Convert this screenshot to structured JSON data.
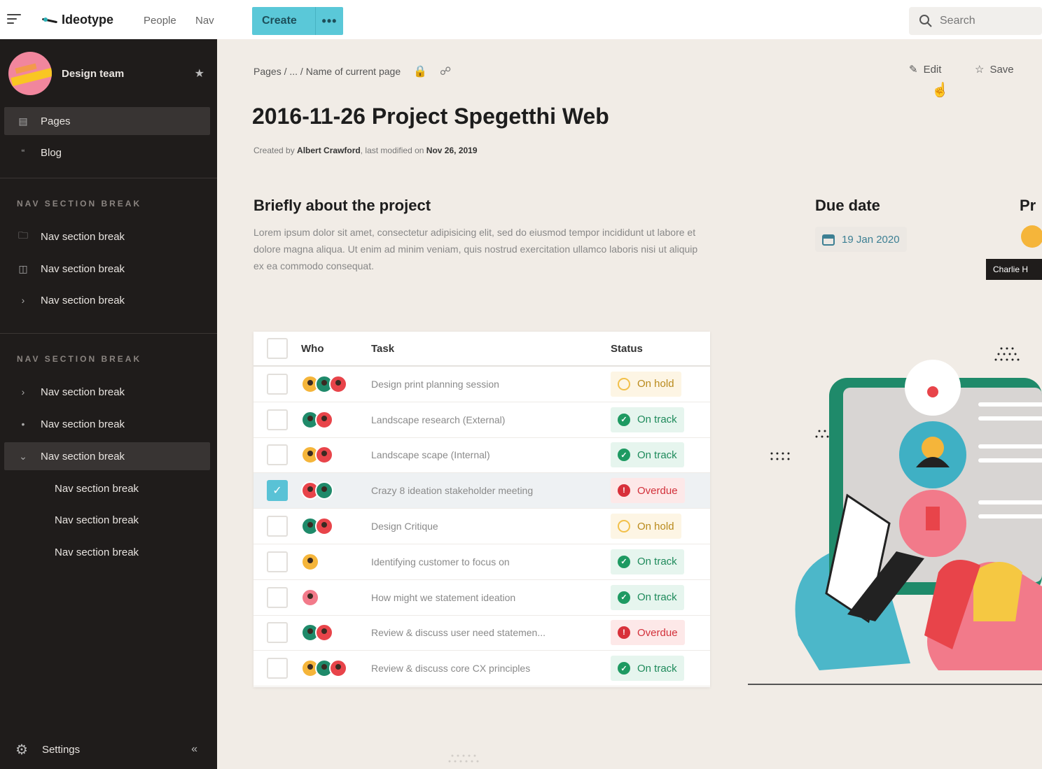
{
  "topbar": {
    "logo": "Ideotype",
    "nav": [
      "People",
      "Nav"
    ],
    "create_label": "Create",
    "create_more": "•••",
    "search_placeholder": "Search"
  },
  "sidebar": {
    "team_name": "Design team",
    "primary_items": [
      {
        "label": "Pages",
        "icon": "pages-icon",
        "active": true
      },
      {
        "label": "Blog",
        "icon": "quote-icon",
        "active": false
      }
    ],
    "section1": {
      "heading": "NAV SECTION BREAK",
      "items": [
        {
          "label": "Nav section break",
          "icon": "folder-icon"
        },
        {
          "label": "Nav section break",
          "icon": "book-icon"
        },
        {
          "label": "Nav section break",
          "icon": "chevron-right-icon"
        }
      ]
    },
    "section2": {
      "heading": "NAV SECTION BREAK",
      "items": [
        {
          "label": "Nav section break",
          "icon": "chevron-right-icon"
        },
        {
          "label": "Nav section break",
          "icon": "bullet-icon"
        },
        {
          "label": "Nav section break",
          "icon": "chevron-down-icon",
          "active": true
        }
      ],
      "sub_items": [
        "Nav section break",
        "Nav section break",
        "Nav section break"
      ]
    },
    "settings_label": "Settings"
  },
  "page": {
    "breadcrumb": "Pages / ... / Name of current page",
    "edit_label": "Edit",
    "save_label": "Save",
    "title": "2016-11-26 Project Spegetthi Web",
    "byline_prefix": "Created by",
    "author": "Albert Crawford",
    "byline_mid": ", last modified on",
    "modified": "Nov 26, 2019",
    "about_title": "Briefly about the project",
    "about_text": "Lorem ipsum dolor sit amet, consectetur adipisicing elit, sed do eiusmod tempor incididunt ut labore et dolore magna aliqua. Ut enim ad minim veniam, quis nostrud exercitation ullamco laboris nisi ut aliquip ex ea commodo consequat.",
    "due_title": "Due date",
    "due_date": "19 Jan 2020",
    "pr_title": "Pr",
    "tooltip": "Charlie H"
  },
  "table": {
    "headers": {
      "who": "Who",
      "task": "Task",
      "status": "Status"
    },
    "rows": [
      {
        "avatars": [
          "o",
          "g",
          "r"
        ],
        "task": "Design print planning session",
        "status": "On hold",
        "kind": "hold",
        "checked": false
      },
      {
        "avatars": [
          "g",
          "r"
        ],
        "task": "Landscape research (External)",
        "status": "On track",
        "kind": "track",
        "checked": false
      },
      {
        "avatars": [
          "o",
          "r"
        ],
        "task": "Landscape scape (Internal)",
        "status": "On track",
        "kind": "track",
        "checked": false
      },
      {
        "avatars": [
          "r",
          "g"
        ],
        "task": "Crazy 8 ideation stakeholder meeting",
        "status": "Overdue",
        "kind": "overdue",
        "checked": true
      },
      {
        "avatars": [
          "g",
          "r"
        ],
        "task": "Design Critique",
        "status": "On hold",
        "kind": "hold",
        "checked": false
      },
      {
        "avatars": [
          "o"
        ],
        "task": "Identifying customer to focus on",
        "status": "On track",
        "kind": "track",
        "checked": false
      },
      {
        "avatars": [
          "p"
        ],
        "task": "How might we statement ideation",
        "status": "On track",
        "kind": "track",
        "checked": false
      },
      {
        "avatars": [
          "g",
          "r"
        ],
        "task": "Review & discuss user need statemen...",
        "status": "Overdue",
        "kind": "overdue",
        "checked": false
      },
      {
        "avatars": [
          "o",
          "g",
          "r"
        ],
        "task": "Review & discuss core CX principles",
        "status": "On track",
        "kind": "track",
        "checked": false
      }
    ]
  }
}
